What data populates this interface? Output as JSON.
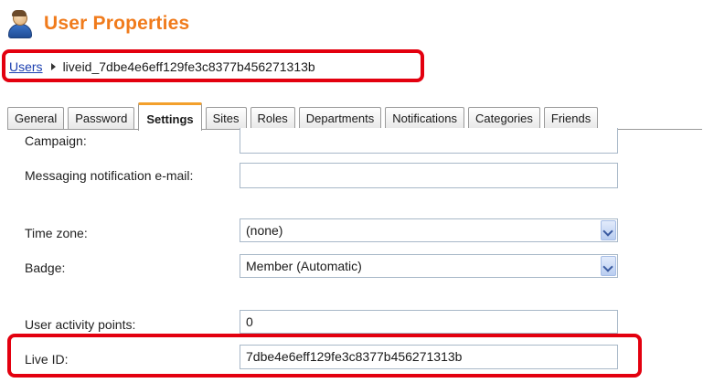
{
  "header": {
    "title": "User Properties"
  },
  "breadcrumb": {
    "link": "Users",
    "current": "liveid_7dbe4e6eff129fe3c8377b456271313b"
  },
  "tabs": [
    {
      "label": "General"
    },
    {
      "label": "Password"
    },
    {
      "label": "Settings",
      "active": true
    },
    {
      "label": "Sites"
    },
    {
      "label": "Roles"
    },
    {
      "label": "Departments"
    },
    {
      "label": "Notifications"
    },
    {
      "label": "Categories"
    },
    {
      "label": "Friends"
    }
  ],
  "form": {
    "campaign": {
      "label": "Campaign:",
      "value": ""
    },
    "messaging_email": {
      "label": "Messaging notification e-mail:",
      "value": ""
    },
    "time_zone": {
      "label": "Time zone:",
      "value": "(none)"
    },
    "badge": {
      "label": "Badge:",
      "value": "Member (Automatic)"
    },
    "activity_points": {
      "label": "User activity points:",
      "value": "0"
    },
    "live_id": {
      "label": "Live ID:",
      "value": "7dbe4e6eff129fe3c8377b456271313b"
    }
  },
  "colors": {
    "title": "#f07b1c",
    "highlight": "#e3000f",
    "active_tab_accent": "#f3a02c",
    "link": "#1b3fb0"
  },
  "icons": {
    "header": "user-icon",
    "breadcrumb_separator": "breadcrumb-arrow-icon",
    "dropdown": "chevron-down-icon"
  }
}
